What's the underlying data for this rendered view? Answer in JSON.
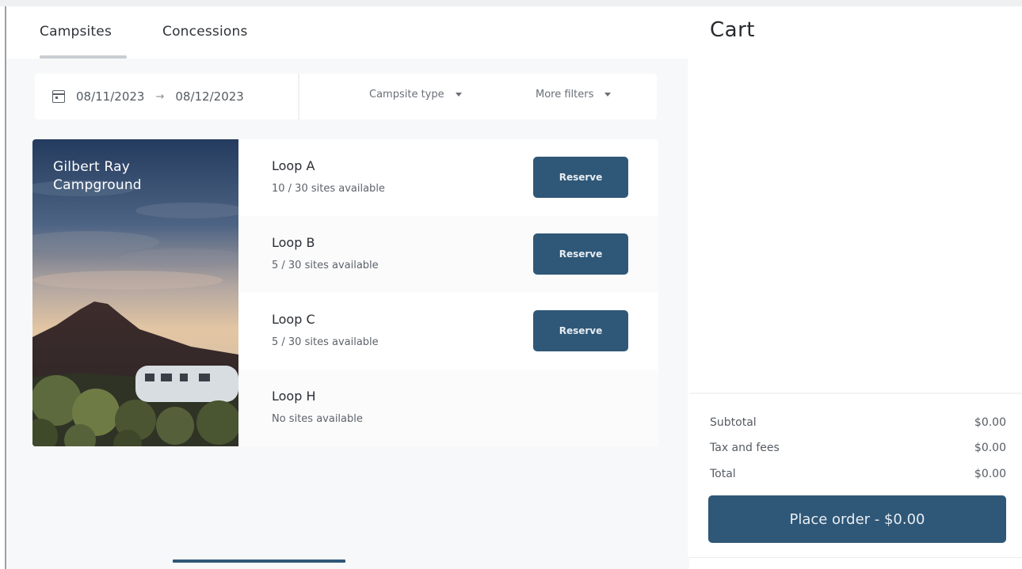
{
  "tabs": [
    {
      "label": "Campsites",
      "active": true
    },
    {
      "label": "Concessions",
      "active": false
    }
  ],
  "filters": {
    "date_start": "08/11/2023",
    "arrow": "→",
    "date_end": "08/12/2023",
    "campsite_type_label": "Campsite type",
    "more_filters_label": "More filters"
  },
  "campground": {
    "name": "Gilbert Ray Campground",
    "loops": [
      {
        "name": "Loop A",
        "availability": "10 / 30 sites available",
        "reserve_label": "Reserve",
        "has_reserve": true
      },
      {
        "name": "Loop B",
        "availability": "5 / 30 sites available",
        "reserve_label": "Reserve",
        "has_reserve": true
      },
      {
        "name": "Loop C",
        "availability": "5 / 30 sites available",
        "reserve_label": "Reserve",
        "has_reserve": true
      },
      {
        "name": "Loop H",
        "availability": "No sites available",
        "has_reserve": false
      }
    ]
  },
  "cart": {
    "title": "Cart",
    "subtotal_label": "Subtotal",
    "subtotal_value": "$0.00",
    "tax_label": "Tax and fees",
    "tax_value": "$0.00",
    "total_label": "Total",
    "total_value": "$0.00",
    "place_order_label": "Place order - $0.00"
  },
  "colors": {
    "accent": "#2f5777",
    "background": "#f7f8f9",
    "panel": "#ffffff"
  },
  "icons": {
    "date": "calendar-icon",
    "dropdown": "caret-down-icon"
  }
}
